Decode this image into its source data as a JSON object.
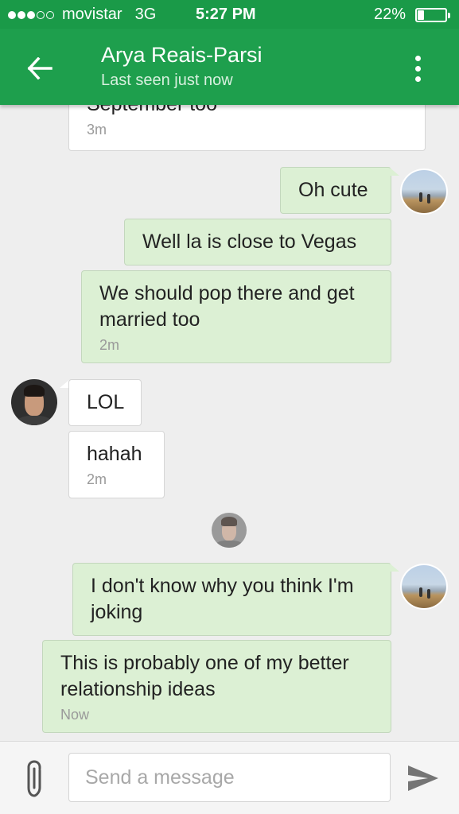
{
  "status_bar": {
    "carrier": "movistar",
    "network": "3G",
    "time": "5:27 PM",
    "battery_text": "22%",
    "battery_level": 0.22,
    "signal_full": 3,
    "signal_total": 5
  },
  "header": {
    "title": "Arya Reais-Parsi",
    "subtitle": "Last seen just now"
  },
  "messages": [
    {
      "dir": "in",
      "text": "September too",
      "time": "3m"
    },
    {
      "dir": "out",
      "text": "Oh cute"
    },
    {
      "dir": "out",
      "text": "Well la is close to Vegas"
    },
    {
      "dir": "out",
      "text": "We should pop there and get married too",
      "time": "2m"
    },
    {
      "dir": "in",
      "text": "LOL"
    },
    {
      "dir": "in",
      "text": "hahah",
      "time": "2m"
    },
    {
      "dir": "out",
      "text": "I don't know why you think I'm joking"
    },
    {
      "dir": "out",
      "text": "This is probably one of my better relationship ideas",
      "time": "Now"
    }
  ],
  "composer": {
    "placeholder": "Send a message",
    "value": ""
  },
  "colors": {
    "header": "#1e9f4d",
    "status_bar": "#1a9a48",
    "outgoing_bubble": "#dcf0d4",
    "incoming_bubble": "#ffffff",
    "background": "#eeeeee"
  },
  "icons": {
    "back": "arrow-left-icon",
    "menu": "more-vertical-icon",
    "attach": "paperclip-icon",
    "send": "send-icon"
  }
}
